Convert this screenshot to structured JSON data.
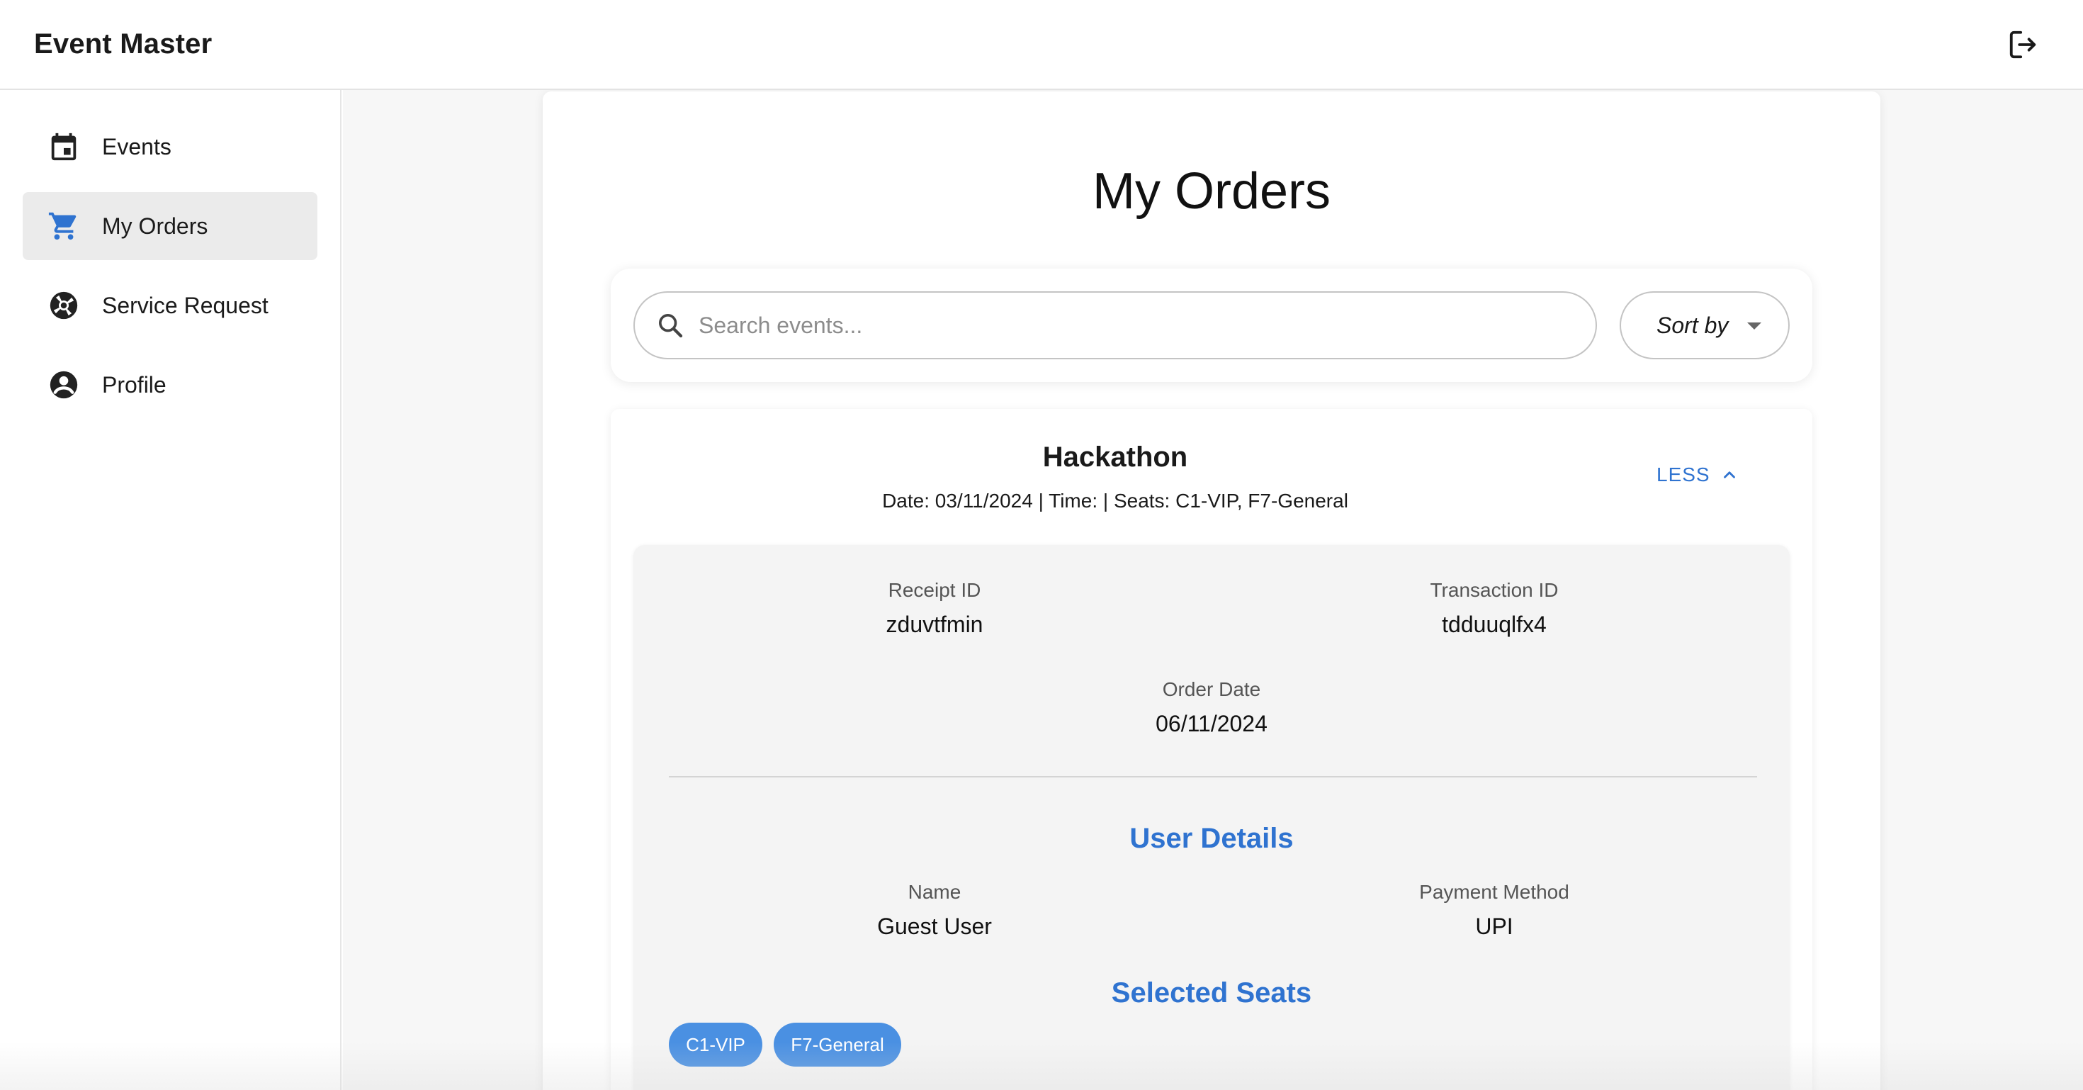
{
  "app": {
    "title": "Event Master"
  },
  "icons": {
    "logout": "logout-icon",
    "events": "calendar-icon",
    "orders": "cart-icon",
    "service": "lifebuoy-icon",
    "profile": "account-circle-icon",
    "search": "search-icon",
    "less": "chevron-up-icon"
  },
  "colors": {
    "accent": "#2f73d0",
    "chip": "#4a90e2",
    "active_nav": "#ebebeb"
  },
  "sidebar": {
    "items": [
      {
        "label": "Events",
        "active": false
      },
      {
        "label": "My Orders",
        "active": true
      },
      {
        "label": "Service Request",
        "active": false
      },
      {
        "label": "Profile",
        "active": false
      }
    ]
  },
  "page": {
    "title": "My Orders"
  },
  "filters": {
    "search_placeholder": "Search events...",
    "search_value": "",
    "sort_label": "Sort by"
  },
  "order": {
    "event_name": "Hackathon",
    "meta": "Date: 03/11/2024 | Time: | Seats: C1-VIP, F7-General",
    "toggle_label": "LESS",
    "receipt_label": "Receipt ID",
    "receipt_value": "zduvtfmin",
    "transaction_label": "Transaction ID",
    "transaction_value": "tdduuqlfx4",
    "order_date_label": "Order Date",
    "order_date_value": "06/11/2024",
    "user_details_heading": "User Details",
    "name_label": "Name",
    "name_value": "Guest User",
    "payment_label": "Payment Method",
    "payment_value": "UPI",
    "seats_heading": "Selected Seats",
    "seats": [
      "C1-VIP",
      "F7-General"
    ]
  }
}
